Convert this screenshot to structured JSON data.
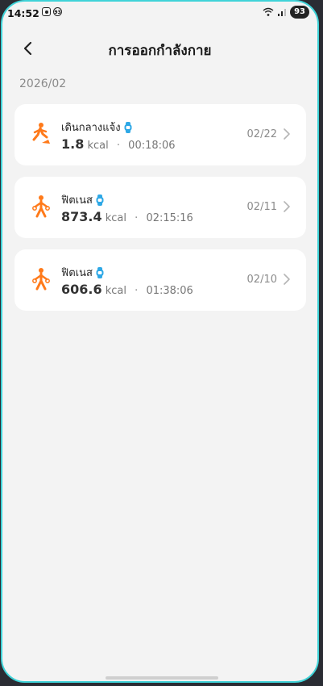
{
  "status": {
    "time": "14:52",
    "notif_badge": "93",
    "battery": "93"
  },
  "header": {
    "title": "การออกกำลังกาย"
  },
  "month": "2026/02",
  "workouts": [
    {
      "name": "เดินกลางแจ้ง",
      "kcal": "1.8",
      "unit": "kcal",
      "duration": "00:18:06",
      "date": "02/22",
      "icon": "outdoor-walk-icon"
    },
    {
      "name": "ฟิตเนส",
      "kcal": "873.4",
      "unit": "kcal",
      "duration": "02:15:16",
      "date": "02/11",
      "icon": "fitness-icon"
    },
    {
      "name": "ฟิตเนส",
      "kcal": "606.6",
      "unit": "kcal",
      "duration": "01:38:06",
      "date": "02/10",
      "icon": "fitness-icon"
    }
  ],
  "colors": {
    "accent_orange": "#ff7a1a",
    "watch_blue": "#2ea8e6",
    "frame": "#3fd3d8"
  }
}
